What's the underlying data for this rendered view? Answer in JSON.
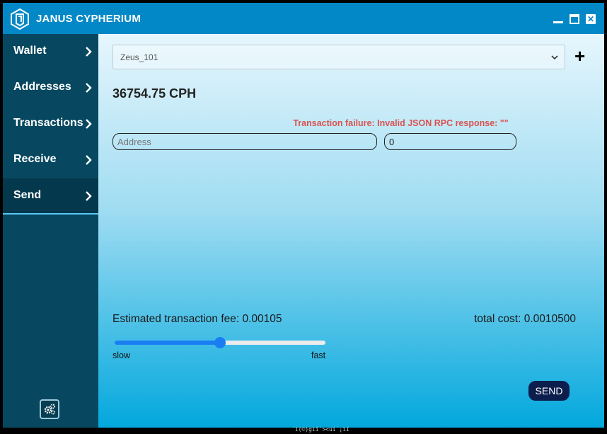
{
  "app": {
    "title": "JANUS CYPHERIUM"
  },
  "window_controls": {
    "close_glyph": "✕"
  },
  "sidebar": {
    "items": [
      {
        "label": "Wallet"
      },
      {
        "label": "Addresses"
      },
      {
        "label": "Transactions"
      },
      {
        "label": "Receive"
      },
      {
        "label": "Send",
        "active": true
      }
    ]
  },
  "send": {
    "wallet_selected": "Zeus_101",
    "add_symbol": "+",
    "balance": "36754.75 CPH",
    "error": "Transaction failure: Invalid JSON RPC response: \"\"",
    "address_placeholder": "Address",
    "amount_value": "0",
    "fee_text": "Estimated transaction fee: 0.00105",
    "total_text": "total cost: 0.0010500",
    "slider_value": 0.5,
    "slow_label": "slow",
    "fast_label": "fast",
    "send_label": "SEND"
  },
  "footer_text": "´ï(©)gïî´><üí´¡ïí",
  "colors": {
    "accent": "#0288c6",
    "sidebar": "#074860",
    "error": "#d9534f",
    "slider": "#1a7ef2",
    "send_button": "#0b1e4d"
  }
}
